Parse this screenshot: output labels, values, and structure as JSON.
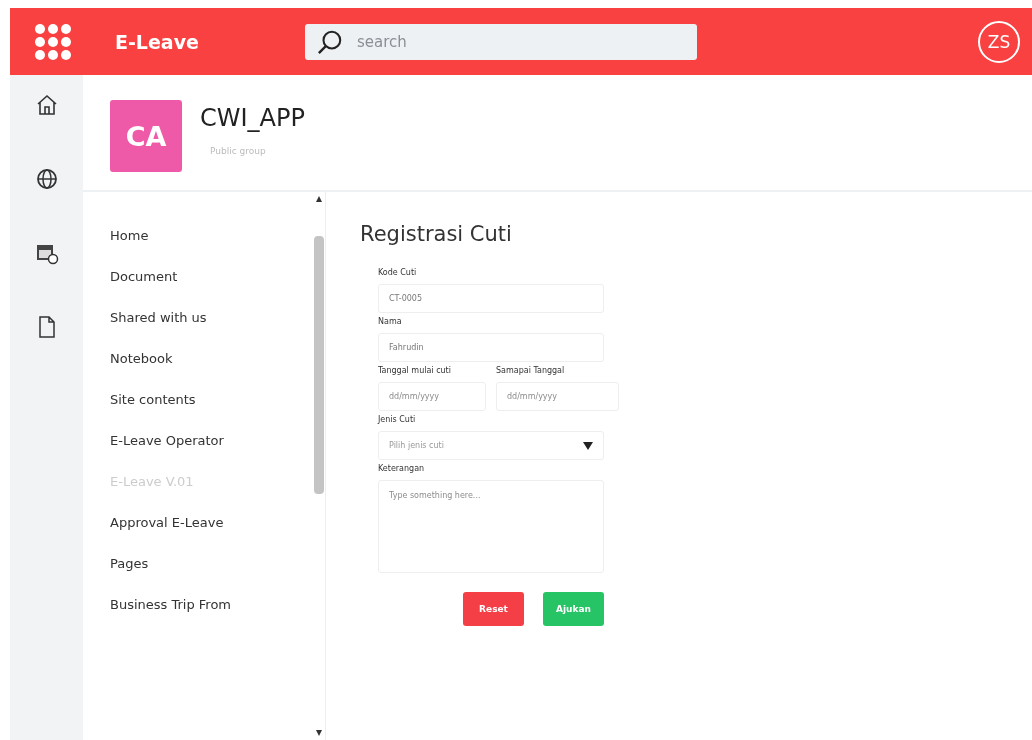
{
  "app_bar": {
    "title": "E-Leave",
    "search": {
      "placeholder": "search"
    },
    "avatar": "ZS"
  },
  "rail": [
    {
      "kind": "home"
    },
    {
      "kind": "globe"
    },
    {
      "kind": "calendar"
    },
    {
      "kind": "document"
    }
  ],
  "group": {
    "initials": "CA",
    "name": "CWI_APP",
    "subtitle": "Public group"
  },
  "nav": [
    {
      "label": "Home",
      "disabled": false
    },
    {
      "label": "Document",
      "disabled": false
    },
    {
      "label": "Shared with us",
      "disabled": false
    },
    {
      "label": "Notebook",
      "disabled": false
    },
    {
      "label": "Site contents",
      "disabled": false
    },
    {
      "label": "E-Leave Operator",
      "disabled": false
    },
    {
      "label": "E-Leave V.01",
      "disabled": true
    },
    {
      "label": "Approval E-Leave",
      "disabled": false
    },
    {
      "label": "Pages",
      "disabled": false
    },
    {
      "label": "Business Trip From",
      "disabled": false
    }
  ],
  "form": {
    "title": "Registrasi Cuti",
    "kode_cuti": {
      "label": "Kode Cuti",
      "value": "CT-0005"
    },
    "nama": {
      "label": "Nama",
      "value": "Fahrudin"
    },
    "tanggal_mulai": {
      "label": "Tanggal mulai",
      "label_suffix": "cuti",
      "placeholder": "dd/mm/yyyy"
    },
    "sampai_tanggal": {
      "label": "Samapai Tanggal",
      "placeholder": "dd/mm/yyyy"
    },
    "jenis_cuti": {
      "label": "Jenis Cuti",
      "placeholder": "Pilih jenis cuti"
    },
    "keterangan": {
      "label": "Keterangan",
      "placeholder": "Type something here..."
    },
    "buttons": [
      {
        "label": "Reset",
        "kind": "reset"
      },
      {
        "label": "Ajukan",
        "kind": "submit"
      }
    ]
  }
}
